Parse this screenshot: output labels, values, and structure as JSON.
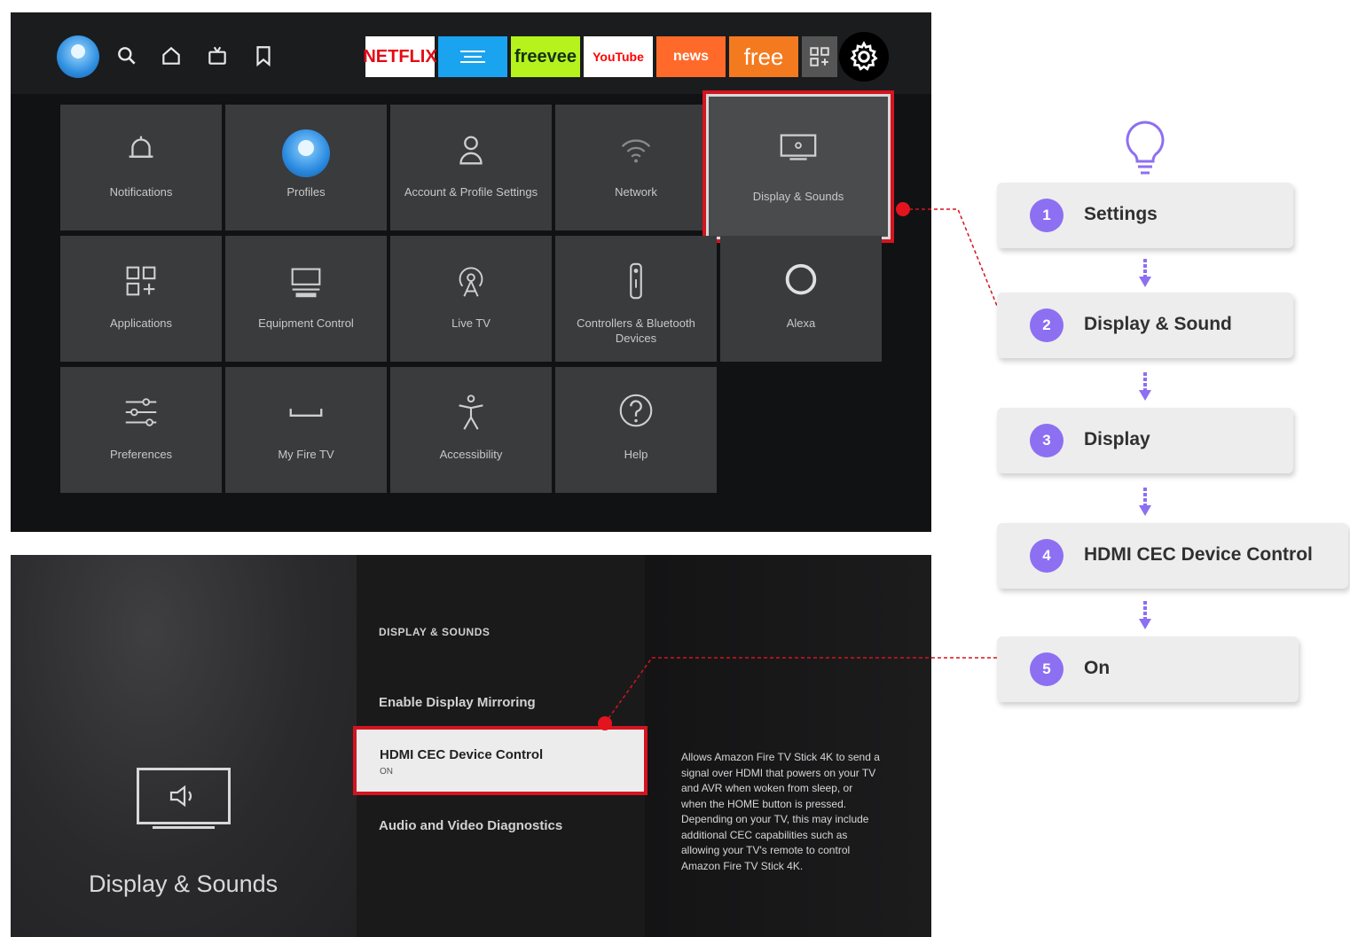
{
  "top_screen": {
    "apps": [
      {
        "label": "NETFLIX",
        "bg": "#ffffff",
        "fg": "#e50914"
      },
      {
        "label": "",
        "bg": "#1aa3ef",
        "fg": "#ffffff"
      },
      {
        "label": "freevee",
        "bg": "#b6f21c",
        "fg": "#12321a"
      },
      {
        "label": "YouTube",
        "bg": "#ffffff",
        "fg": "#ff0000"
      },
      {
        "label": "news",
        "bg": "#ff6a2b",
        "fg": "#ffffff"
      },
      {
        "label": "free",
        "bg": "#f47a1f",
        "fg": "#ffffff"
      }
    ],
    "tiles": [
      {
        "label": "Notifications",
        "icon": "bell-icon"
      },
      {
        "label": "Profiles",
        "icon": "profile-icon"
      },
      {
        "label": "Account & Profile Settings",
        "icon": "person-icon"
      },
      {
        "label": "Network",
        "icon": "wifi-icon"
      },
      {
        "label": "Display & Sounds",
        "icon": "display-icon"
      },
      {
        "label": "Applications",
        "icon": "apps-icon"
      },
      {
        "label": "Equipment Control",
        "icon": "equipment-icon"
      },
      {
        "label": "Live TV",
        "icon": "antenna-icon"
      },
      {
        "label": "Controllers & Bluetooth Devices",
        "icon": "remote-icon"
      },
      {
        "label": "Alexa",
        "icon": "alexa-icon"
      },
      {
        "label": "Preferences",
        "icon": "sliders-icon"
      },
      {
        "label": "My Fire TV",
        "icon": "firetv-icon"
      },
      {
        "label": "Accessibility",
        "icon": "accessibility-icon"
      },
      {
        "label": "Help",
        "icon": "help-icon"
      }
    ]
  },
  "bottom_screen": {
    "section_title": "Display & Sounds",
    "breadcrumb": "DISPLAY & SOUNDS",
    "menu": {
      "item1": "Enable Display Mirroring",
      "selected_title": "HDMI CEC Device Control",
      "selected_value": "ON",
      "item3": "Audio and Video Diagnostics"
    },
    "description": "Allows Amazon Fire TV Stick 4K to send a signal over HDMI that powers on your TV and AVR when woken from sleep, or when the HOME button is pressed. Depending on your TV, this may include additional CEC capabilities such as allowing your TV's remote to control Amazon Fire TV Stick 4K."
  },
  "steps": [
    {
      "num": "1",
      "label": "Settings"
    },
    {
      "num": "2",
      "label": "Display & Sound"
    },
    {
      "num": "3",
      "label": "Display"
    },
    {
      "num": "4",
      "label": "HDMI CEC Device Control"
    },
    {
      "num": "5",
      "label": "On"
    }
  ],
  "colors": {
    "highlight_red": "#d4141f",
    "step_badge": "#8d6ff2",
    "arrow": "#8d6ff2"
  }
}
